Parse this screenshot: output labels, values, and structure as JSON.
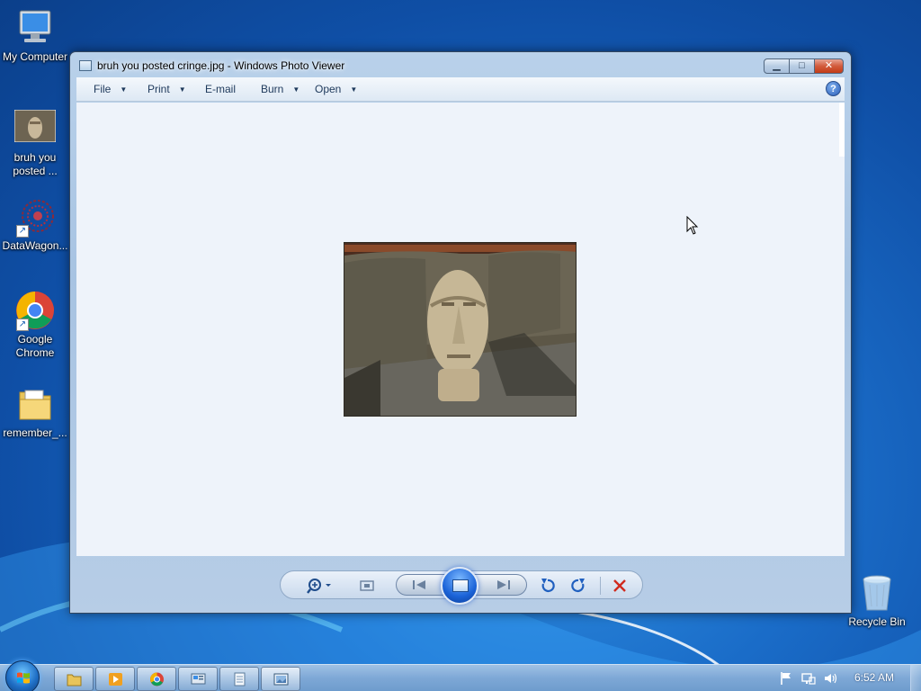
{
  "desktop": {
    "icons": [
      {
        "label": "My Computer",
        "icon": "computer-icon"
      },
      {
        "label": "bruh you posted ...",
        "icon": "image-thumbnail-icon"
      },
      {
        "label": "DataWagon...",
        "icon": "datawagon-icon"
      },
      {
        "label": "Google Chrome",
        "icon": "chrome-icon"
      },
      {
        "label": "remember_...",
        "icon": "folder-icon"
      },
      {
        "label": "Recycle Bin",
        "icon": "recycle-bin-icon"
      }
    ]
  },
  "window": {
    "title": "bruh you posted cringe.jpg - Windows Photo Viewer",
    "caption_buttons": {
      "minimize": "minimize",
      "maximize": "maximize",
      "close": "close"
    },
    "menu": [
      {
        "label": "File",
        "has_dropdown": true
      },
      {
        "label": "Print",
        "has_dropdown": true
      },
      {
        "label": "E-mail",
        "has_dropdown": false
      },
      {
        "label": "Burn",
        "has_dropdown": true
      },
      {
        "label": "Open",
        "has_dropdown": true
      }
    ],
    "help": "?",
    "photo": {
      "subject": "moai-head-statue-on-couch"
    },
    "controls": {
      "zoom": "zoom-icon",
      "actual_size": "fit-window-icon",
      "previous": "previous-icon",
      "slideshow": "slideshow-icon",
      "next": "next-icon",
      "rotate_ccw": "rotate-counterclockwise-icon",
      "rotate_cw": "rotate-clockwise-icon",
      "delete": "delete-icon"
    }
  },
  "taskbar": {
    "pinned": [
      "explorer-icon",
      "media-player-icon",
      "chrome-icon",
      "control-panel-icon",
      "notepad-icon",
      "photo-viewer-icon"
    ],
    "tray": [
      "action-center-flag-icon",
      "network-icon",
      "volume-icon"
    ],
    "clock": "6:52 AM"
  },
  "colors": {
    "close_red": "#c23c18",
    "accent_blue": "#1f6fc6",
    "menu_text": "#1e395b"
  }
}
